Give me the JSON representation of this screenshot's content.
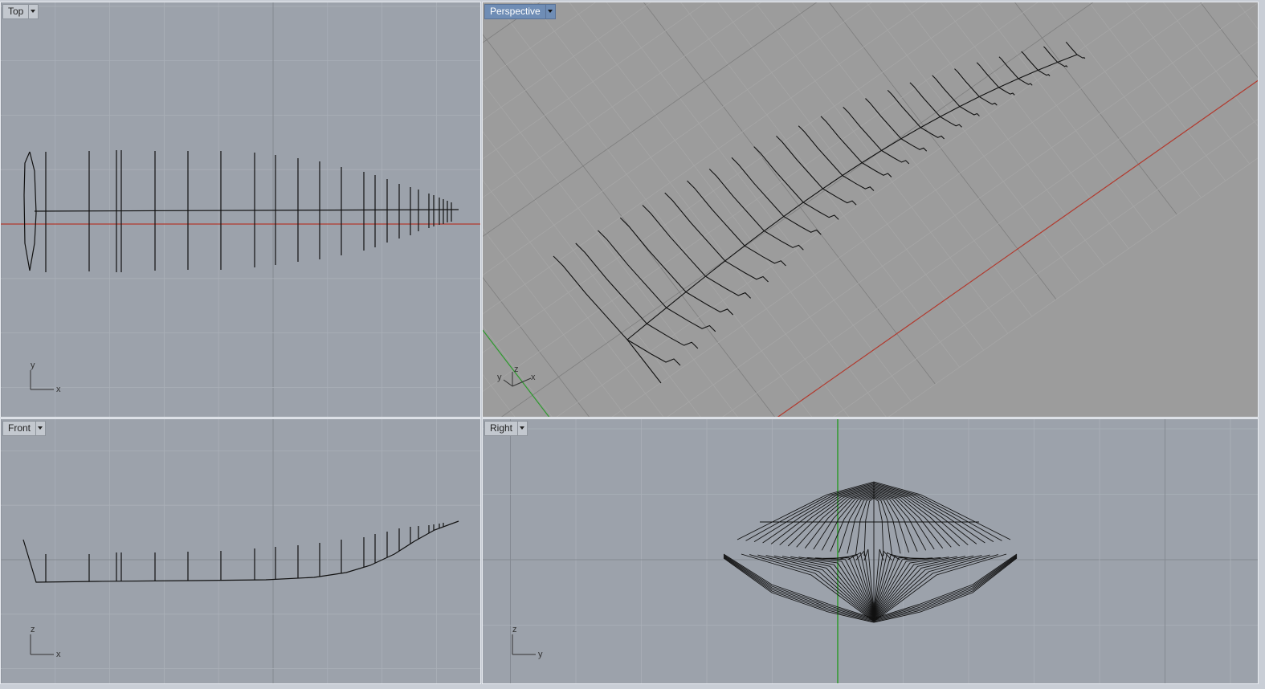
{
  "viewports": {
    "top": {
      "label": "Top",
      "axis_h": "x",
      "axis_v": "y"
    },
    "perspective": {
      "label": "Perspective",
      "axis_y": "y",
      "axis_z": "z",
      "axis_x": "x",
      "active": true
    },
    "front": {
      "label": "Front",
      "axis_h": "x",
      "axis_v": "z"
    },
    "right": {
      "label": "Right",
      "axis_h": "y",
      "axis_v": "z"
    }
  },
  "colors": {
    "viewport_bg": "#9ca2ab",
    "perspective_bg": "#9c9c9c",
    "grid_minor": "#aab0b8",
    "grid_major": "#858a92",
    "x_axis": "#b33a2e",
    "y_axis": "#2e9a2e",
    "geometry": "#111111",
    "active_tab": "#6f8db5"
  },
  "icons": {
    "viewport_menu": "chevron-down-icon",
    "axis_widget": "axis-triad-icon"
  }
}
